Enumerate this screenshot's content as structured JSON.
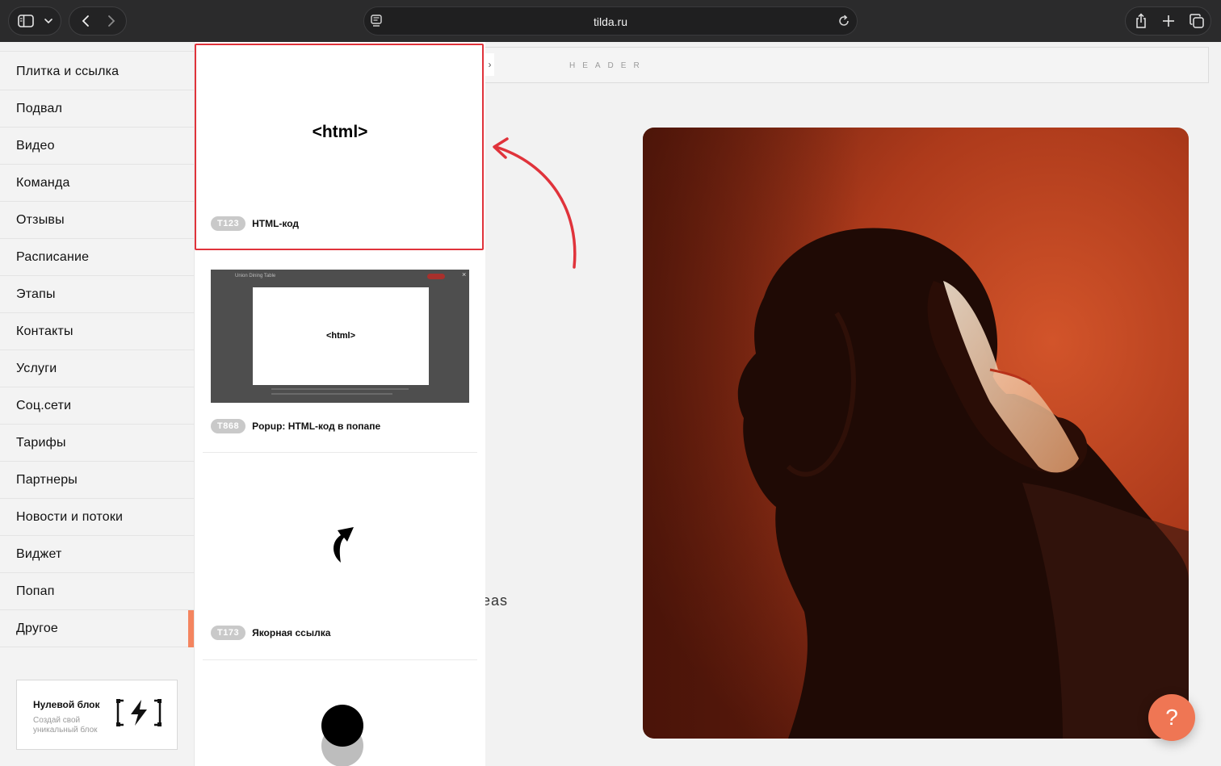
{
  "browser": {
    "url": "tilda.ru",
    "icons": [
      "sidebar-icon",
      "chevron-down-icon",
      "back-icon",
      "forward-icon",
      "page-icon",
      "reload-icon",
      "share-icon",
      "plus-icon",
      "tabs-icon"
    ]
  },
  "sidebar": {
    "categories": [
      "Плитка и ссылка",
      "Подвал",
      "Видео",
      "Команда",
      "Отзывы",
      "Расписание",
      "Этапы",
      "Контакты",
      "Услуги",
      "Соц.сети",
      "Тарифы",
      "Партнеры",
      "Новости и потоки",
      "Виджет",
      "Попап",
      "Другое"
    ],
    "active": "Другое",
    "accent_color": "#f4845f",
    "zero_block": {
      "title": "Нулевой блок",
      "subtitle": "Создай свой уникальный блок"
    }
  },
  "library": {
    "cards": [
      {
        "code": "T123",
        "name": "HTML-код",
        "preview_text": "<html>",
        "highlighted": true
      },
      {
        "code": "T868",
        "name": "Popup: HTML-код в попапе",
        "preview_text": "<html>",
        "preview_caption": "Union Dining Table"
      },
      {
        "code": "T173",
        "name": "Якорная ссылка"
      },
      {
        "code": "",
        "name": ""
      }
    ],
    "highlight_color": "#e0333b"
  },
  "canvas": {
    "header_label": "HEADER",
    "partial_text": "eas",
    "help_label": "?"
  }
}
